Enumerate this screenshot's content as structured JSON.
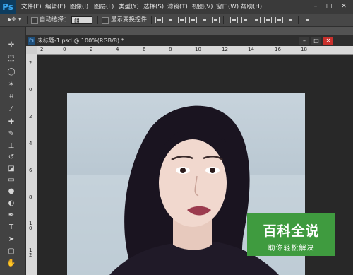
{
  "app": {
    "logo": "Ps"
  },
  "menubar": {
    "items": [
      "文件(F)",
      "编辑(E)",
      "图像(I)",
      "图层(L)",
      "类型(Y)",
      "选择(S)",
      "滤镜(T)",
      "视图(V)",
      "窗口(W)",
      "帮助(H)"
    ],
    "window_buttons": [
      "–",
      "□",
      "✕"
    ]
  },
  "options": {
    "auto_select_label": "自动选择：",
    "auto_select_value": "组",
    "show_transform_label": "显示变换控件"
  },
  "document": {
    "tab_title": "未标题-1.psd @ 100%(RGB/8) *",
    "window_buttons": [
      "–",
      "□",
      "✕"
    ]
  },
  "ruler": {
    "top_ticks": [
      "2",
      "0",
      "2",
      "4",
      "6",
      "8",
      "10",
      "12",
      "14",
      "16",
      "18"
    ],
    "left_ticks": [
      "2",
      "0",
      "2",
      "4",
      "6",
      "8",
      "1\n0",
      "1\n2"
    ]
  },
  "watermark": {
    "main": "百科全说",
    "sub": "助你轻松解决"
  },
  "colors": {
    "accent": "#0d3c5e",
    "watermark": "#3f9b3f"
  }
}
